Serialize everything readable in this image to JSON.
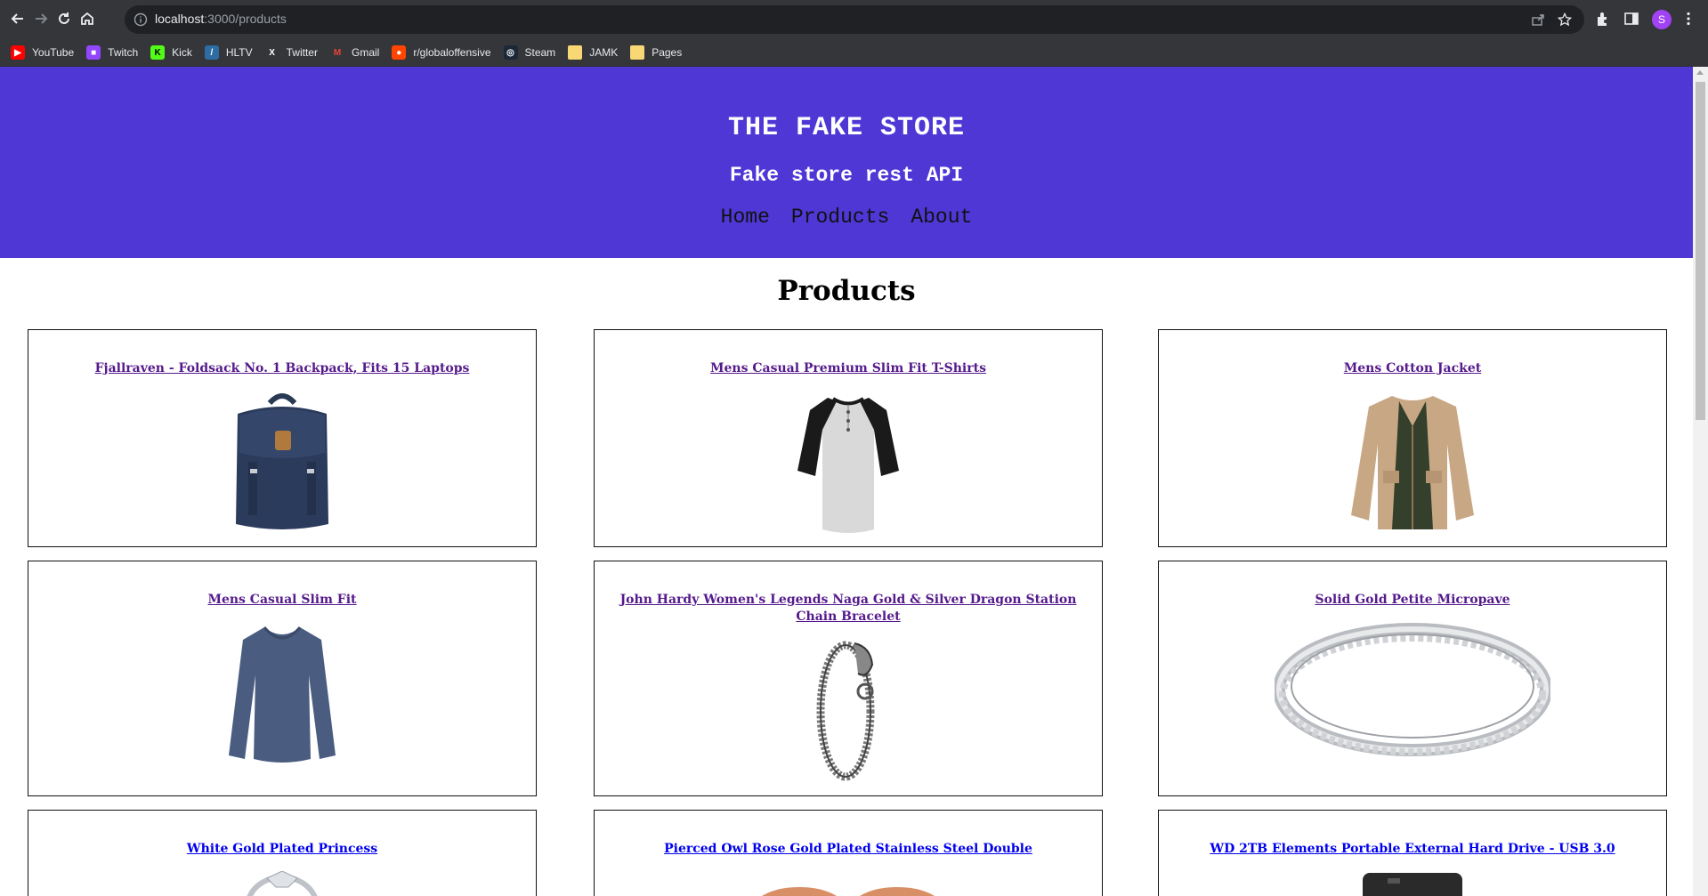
{
  "browser": {
    "url_host": "localhost",
    "url_path": ":3000/products",
    "profile_initial": "S"
  },
  "bookmarks": [
    {
      "label": "YouTube",
      "icon": "youtube-icon",
      "color": "#ff0000"
    },
    {
      "label": "Twitch",
      "icon": "twitch-icon",
      "color": "#9146ff"
    },
    {
      "label": "Kick",
      "icon": "kick-icon",
      "color": "#53fc18"
    },
    {
      "label": "HLTV",
      "icon": "hltv-icon",
      "color": "#2d6da3"
    },
    {
      "label": "Twitter",
      "icon": "x-icon",
      "color": "#000000"
    },
    {
      "label": "Gmail",
      "icon": "gmail-icon",
      "color": "#ea4335"
    },
    {
      "label": "r/globaloffensive",
      "icon": "reddit-icon",
      "color": "#ff4500"
    },
    {
      "label": "Steam",
      "icon": "steam-icon",
      "color": "#1b2838"
    },
    {
      "label": "JAMK",
      "icon": "folder-icon",
      "color": "#f8d775"
    },
    {
      "label": "Pages",
      "icon": "folder-icon",
      "color": "#f8d775"
    }
  ],
  "site": {
    "title": "THE FAKE STORE",
    "subtitle": "Fake store rest API",
    "nav": [
      "Home",
      "Products",
      "About"
    ],
    "header_color": "#4f37d6"
  },
  "page": {
    "heading": "Products"
  },
  "products": [
    {
      "title": "Fjallraven - Foldsack No. 1 Backpack, Fits 15 Laptops",
      "image": "backpack",
      "visited": true
    },
    {
      "title": "Mens Casual Premium Slim Fit T-Shirts",
      "image": "raglan-tshirt",
      "visited": true
    },
    {
      "title": "Mens Cotton Jacket",
      "image": "cotton-jacket",
      "visited": true
    },
    {
      "title": "Mens Casual Slim Fit",
      "image": "long-sleeve-shirt",
      "visited": true
    },
    {
      "title": "John Hardy Women's Legends Naga Gold & Silver Dragon Station Chain Bracelet",
      "image": "dragon-bracelet",
      "visited": true
    },
    {
      "title": "Solid Gold Petite Micropave",
      "image": "silver-ring",
      "visited": true
    },
    {
      "title": "White Gold Plated Princess",
      "image": "princess-ring",
      "visited": false
    },
    {
      "title": "Pierced Owl Rose Gold Plated Stainless Steel Double",
      "image": "rose-gold-earrings",
      "visited": false
    },
    {
      "title": "WD 2TB Elements Portable External Hard Drive - USB 3.0",
      "image": "hard-drive",
      "visited": false
    }
  ]
}
